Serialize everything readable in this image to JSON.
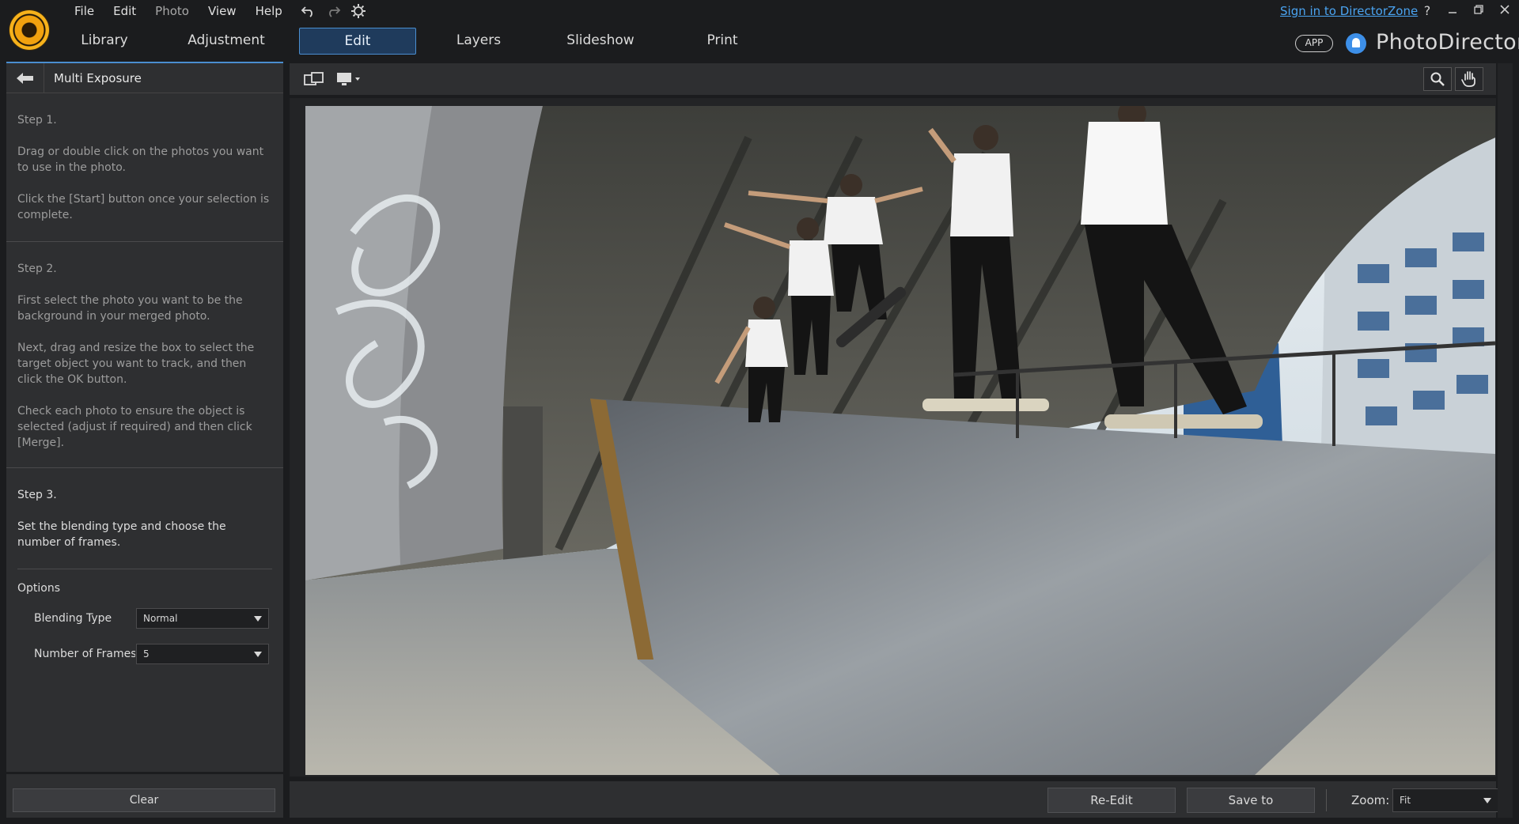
{
  "menu": {
    "file": "File",
    "edit": "Edit",
    "photo": "Photo",
    "view": "View",
    "help": "Help"
  },
  "tabs": [
    {
      "label": "Library"
    },
    {
      "label": "Adjustment"
    },
    {
      "label": "Edit"
    },
    {
      "label": "Layers"
    },
    {
      "label": "Slideshow"
    },
    {
      "label": "Print"
    }
  ],
  "active_tab": "Edit",
  "header_right": {
    "signin": "Sign in to DirectorZone",
    "help": "?",
    "app_badge": "APP",
    "brand": "PhotoDirector"
  },
  "icons": {
    "undo": "undo-icon",
    "redo": "redo-icon",
    "settings": "gear-icon",
    "back": "back-arrow-icon",
    "compare": "compare-view-icon",
    "display": "monitor-icon",
    "zoom_tool": "magnifier-icon",
    "pan_tool": "hand-icon"
  },
  "colors": {
    "accent": "#4a8ed0",
    "link": "#4aa3f0",
    "panel": "#2e2f31",
    "background": "#1b1c1e"
  },
  "panel": {
    "title": "Multi Exposure",
    "step1_title": "Step 1.",
    "step1_text1": "Drag or double click on the photos you want to use in the photo.",
    "step1_text2": "Click the [Start] button once your selection is complete.",
    "step2_title": "Step 2.",
    "step2_text1": "First select the photo you want to be the background in your merged photo.",
    "step2_text2": "Next, drag and resize the box to select the target object you want to track, and then click the OK button.",
    "step2_text3": "Check each photo to ensure the object is selected (adjust if required) and then click [Merge].",
    "step3_title": "Step 3.",
    "step3_text": "Set the blending type and choose the number of frames.",
    "options_title": "Options",
    "blending_label": "Blending Type",
    "blending_value": "Normal",
    "frames_label": "Number of Frames",
    "frames_value": "5",
    "clear_label": "Clear"
  },
  "bottom": {
    "reedit_label": "Re-Edit",
    "saveto_label": "Save to",
    "zoom_label": "Zoom:",
    "zoom_value": "Fit"
  }
}
